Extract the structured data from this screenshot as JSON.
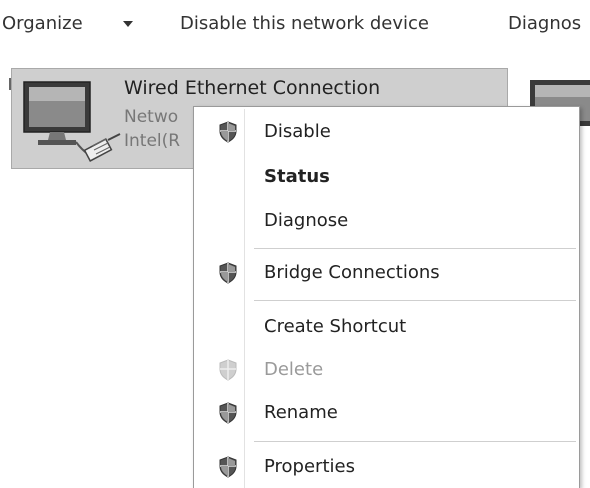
{
  "toolbar": {
    "organize_label": "Organize",
    "disable_label": "Disable this network device",
    "diagnose_label": "Diagnos"
  },
  "adapter": {
    "name": "Wired Ethernet Connection",
    "status": "Netwo",
    "device": "Intel(R"
  },
  "menu": {
    "items": [
      {
        "label": "Disable",
        "shield": true,
        "bold": false,
        "disabled": false
      },
      {
        "label": "Status",
        "shield": false,
        "bold": true,
        "disabled": false
      },
      {
        "label": "Diagnose",
        "shield": false,
        "bold": false,
        "disabled": false
      },
      {
        "label": "Bridge Connections",
        "shield": true,
        "bold": false,
        "disabled": false
      },
      {
        "label": "Create Shortcut",
        "shield": false,
        "bold": false,
        "disabled": false
      },
      {
        "label": "Delete",
        "shield": true,
        "bold": false,
        "disabled": true
      },
      {
        "label": "Rename",
        "shield": true,
        "bold": false,
        "disabled": false
      },
      {
        "label": "Properties",
        "shield": true,
        "bold": false,
        "disabled": false
      }
    ]
  },
  "icons": {
    "organize_dropdown": "chevron-down-icon",
    "adapter": "network-adapter-icon",
    "uac": "shield-icon"
  }
}
